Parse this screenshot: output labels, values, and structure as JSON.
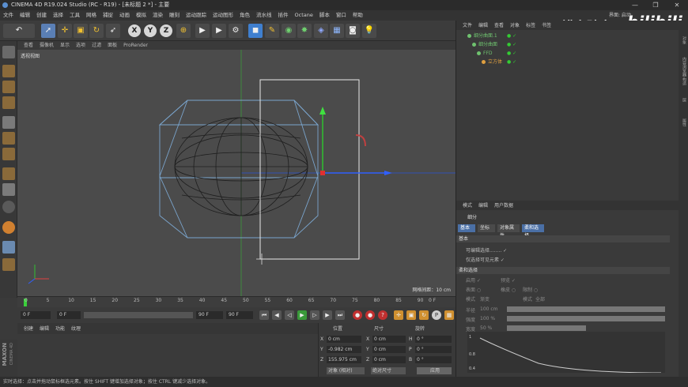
{
  "window": {
    "title": "CINEMA 4D R19.024 Studio (RC - R19) - [未标题 2 *] - 主要",
    "btn_min": "—",
    "btn_max": "❐",
    "btn_close": "✕"
  },
  "menubar": [
    "文件",
    "编辑",
    "创建",
    "选择",
    "工具",
    "网格",
    "捕捉",
    "动画",
    "模拟",
    "渲染",
    "雕刻",
    "运动跟踪",
    "运动图形",
    "角色",
    "流水线",
    "插件",
    "Octane",
    "脚本",
    "窗口",
    "帮助"
  ],
  "menubar_right": "界面: 启动",
  "watermark": {
    "text": "不错实验室",
    "brand": "bilibili"
  },
  "viewport": {
    "menu": [
      "查看",
      "摄像机",
      "显示",
      "选项",
      "过滤",
      "面板",
      "ProRender"
    ],
    "label": "透视视图",
    "grid_info": "网格间距：10 cm"
  },
  "timeline": {
    "ticks": [
      "0",
      "5",
      "10",
      "15",
      "20",
      "25",
      "30",
      "35",
      "40",
      "45",
      "50",
      "55",
      "60",
      "65",
      "70",
      "75",
      "80",
      "85",
      "90"
    ],
    "frame_end": "0 F"
  },
  "playbar": {
    "start": "0 F",
    "current": "0 F",
    "end1": "90 F",
    "end2": "90 F"
  },
  "materials": {
    "tabs": [
      "创建",
      "编辑",
      "功能",
      "纹理"
    ]
  },
  "coords": {
    "headers": [
      "位置",
      "尺寸",
      "旋转"
    ],
    "rows": [
      [
        "X",
        "0 cm",
        "X",
        "0 cm",
        "H",
        "0 °"
      ],
      [
        "Y",
        "-0.982 cm",
        "Y",
        "0 cm",
        "P",
        "0 °"
      ],
      [
        "Z",
        "155.975 cm",
        "Z",
        "0 cm",
        "B",
        "0 °"
      ]
    ],
    "mode": "对象 (相对)",
    "size_mode": "绝对尺寸",
    "apply": "应用"
  },
  "objects": {
    "menu": [
      "文件",
      "编辑",
      "查看",
      "对象",
      "标签",
      "书签"
    ],
    "rows": [
      {
        "name": "细分曲面.1",
        "color": "#6fc26f"
      },
      {
        "name": "细分曲面",
        "color": "#6fc26f"
      },
      {
        "name": "FFD",
        "color": "#6fc26f"
      },
      {
        "name": "立方体",
        "color": "#e0a040"
      }
    ]
  },
  "attributes": {
    "menu": [
      "模式",
      "编辑",
      "用户数据"
    ],
    "object_label": "细分",
    "tabs": [
      "基本",
      "坐标",
      "对象属性",
      "柔和选择"
    ],
    "section1": "基本",
    "fields": [
      "可编辑选择........ ✓",
      "仅选择可见元素 ✓"
    ],
    "section2": "柔和选择",
    "soft_rows": [
      "启用 ✓",
      "预览 ✓",
      "表面 ○",
      "橡皮 ○",
      "限制 ○",
      "模式",
      "渐变",
      "模式",
      "全部",
      "半径",
      "100 cm",
      "强度",
      "100 %",
      "宽度",
      "50 %"
    ],
    "graph_labels": [
      "1",
      "0.8",
      "0.4"
    ]
  },
  "statusbar": "实时选择：点击并拖动鼠标框选元素。按住 SHIFT 键增加选择对象；按住 CTRL 键减少选择对象。",
  "right_strip": [
    "对象",
    "内容浏览器",
    "构造",
    "层",
    "属性"
  ],
  "maxon": [
    "MAXON",
    "CINEMA 4D"
  ]
}
